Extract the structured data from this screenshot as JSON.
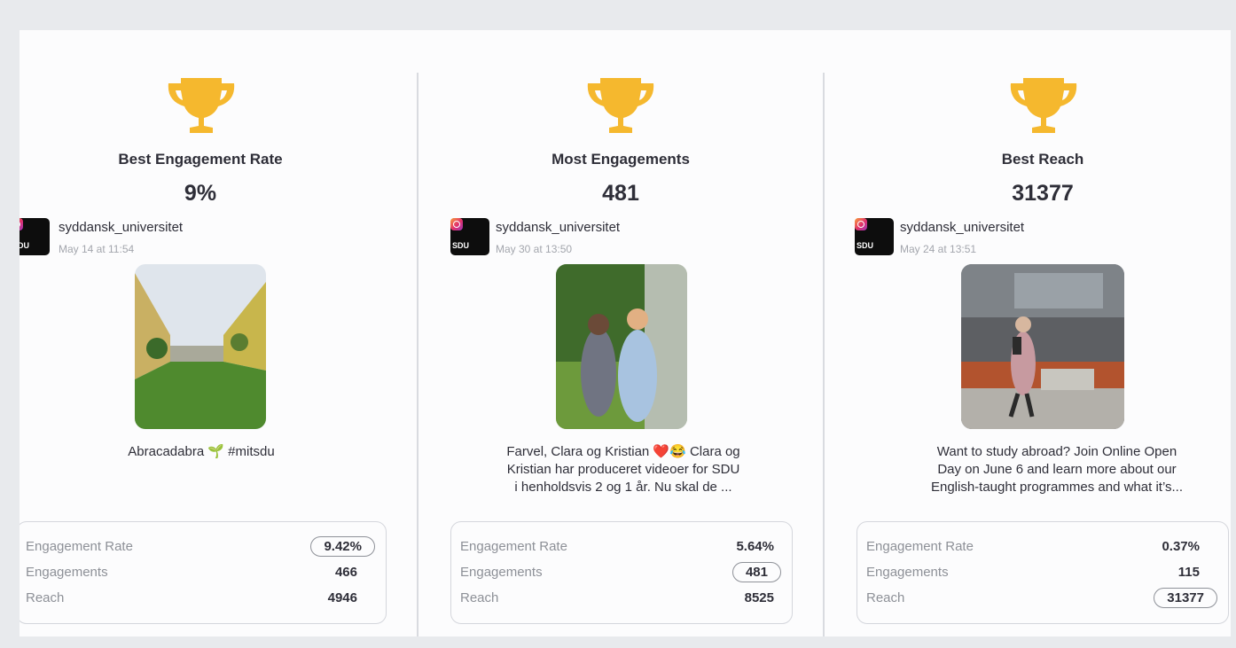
{
  "colors": {
    "trophy": "#f5b82e",
    "background": "#e8eaed",
    "panel": "#fcfcfd"
  },
  "cards": [
    {
      "icon": "trophy-icon",
      "title": "Best Engagement Rate",
      "value": "9%",
      "account": {
        "logo": "SDU",
        "handle": "syddansk_universitet",
        "date": "May 14 at 11:54"
      },
      "caption": "Abracadabra 🌱 #mitsdu",
      "stats": [
        {
          "label": "Engagement Rate",
          "value": "9.42%",
          "highlighted": true
        },
        {
          "label": "Engagements",
          "value": "466",
          "highlighted": false
        },
        {
          "label": "Reach",
          "value": "4946",
          "highlighted": false
        }
      ]
    },
    {
      "icon": "trophy-icon",
      "title": "Most Engagements",
      "value": "481",
      "account": {
        "logo": "SDU",
        "handle": "syddansk_universitet",
        "date": "May 30 at 13:50"
      },
      "caption": "Farvel, Clara og Kristian ❤️😂 Clara og Kristian har produceret videoer for SDU i henholdsvis 2 og 1 år. Nu skal de ...",
      "stats": [
        {
          "label": "Engagement Rate",
          "value": "5.64%",
          "highlighted": false
        },
        {
          "label": "Engagements",
          "value": "481",
          "highlighted": true
        },
        {
          "label": "Reach",
          "value": "8525",
          "highlighted": false
        }
      ]
    },
    {
      "icon": "trophy-icon",
      "title": "Best Reach",
      "value": "31377",
      "account": {
        "logo": "SDU",
        "handle": "syddansk_universitet",
        "date": "May 24 at 13:51"
      },
      "caption": "Want to study abroad? Join Online Open Day on June 6 and learn more about our English-taught programmes and what it’s...",
      "stats": [
        {
          "label": "Engagement Rate",
          "value": "0.37%",
          "highlighted": false
        },
        {
          "label": "Engagements",
          "value": "115",
          "highlighted": false
        },
        {
          "label": "Reach",
          "value": "31377",
          "highlighted": true
        }
      ]
    }
  ]
}
